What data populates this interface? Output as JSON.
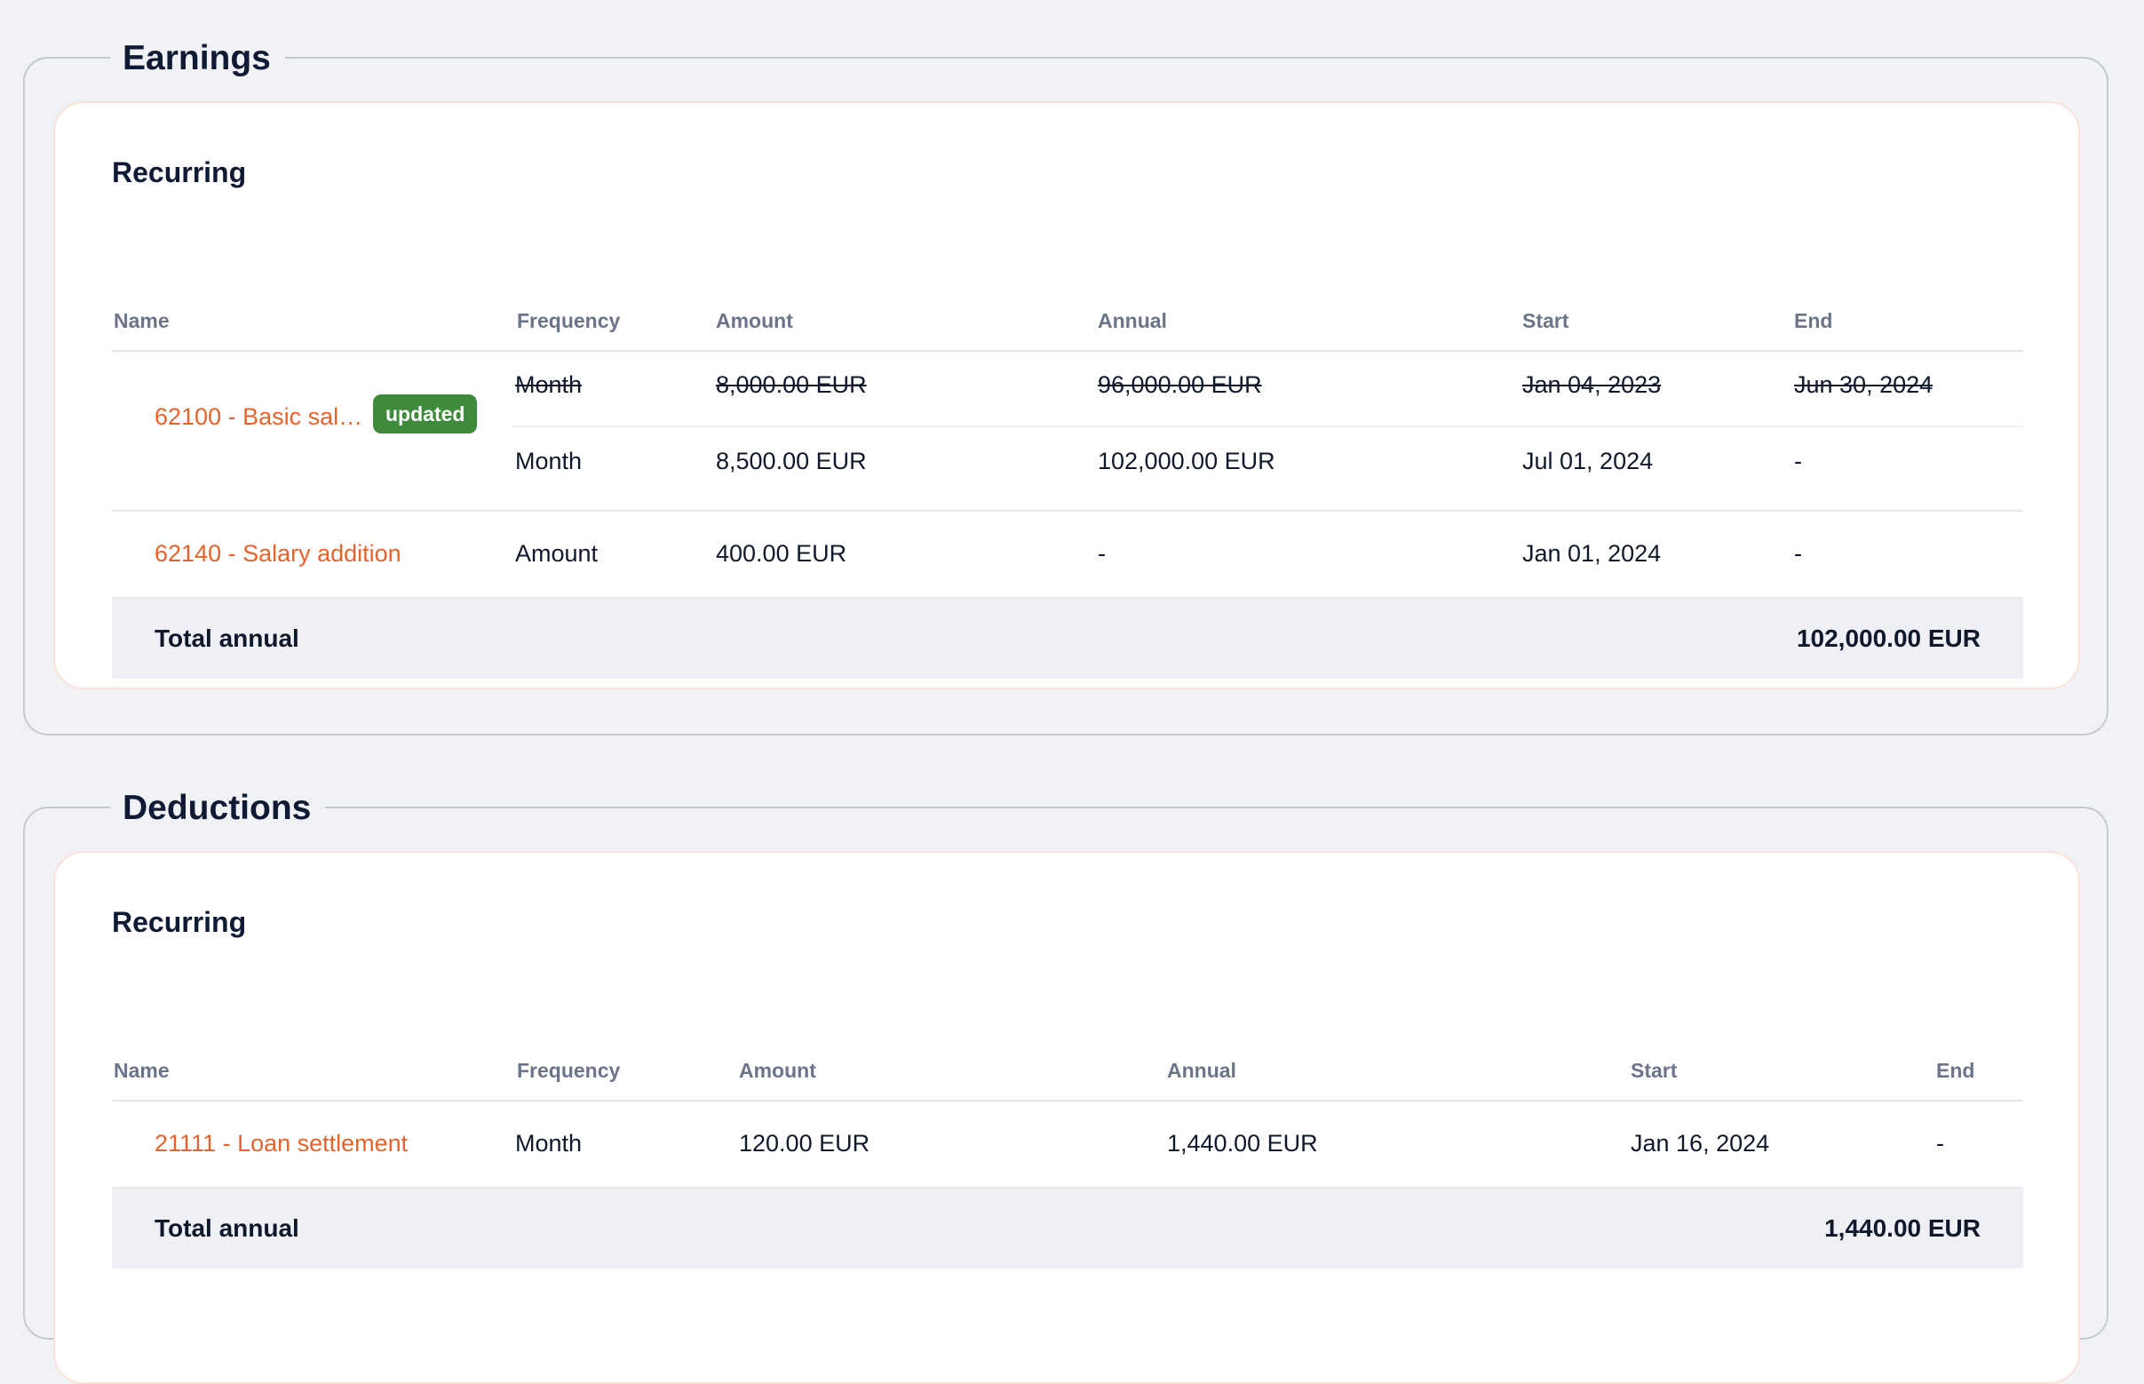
{
  "earnings": {
    "legend": "Earnings",
    "section_title": "Recurring",
    "columns": [
      "Name",
      "Frequency",
      "Amount",
      "Annual",
      "Start",
      "End"
    ],
    "rows": [
      {
        "name": "62100 - Basic sal…",
        "badge": "updated",
        "old": {
          "frequency": "Month",
          "amount": "8,000.00 EUR",
          "annual": "96,000.00 EUR",
          "start": "Jan 04, 2023",
          "end": "Jun 30, 2024"
        },
        "current": {
          "frequency": "Month",
          "amount": "8,500.00 EUR",
          "annual": "102,000.00 EUR",
          "start": "Jul 01, 2024",
          "end": "-"
        }
      },
      {
        "name": "62140 - Salary addition",
        "frequency": "Amount",
        "amount": "400.00 EUR",
        "annual": "-",
        "start": "Jan 01, 2024",
        "end": "-"
      }
    ],
    "total_label": "Total annual",
    "total_value": "102,000.00 EUR"
  },
  "deductions": {
    "legend": "Deductions",
    "section_title": "Recurring",
    "columns": [
      "Name",
      "Frequency",
      "Amount",
      "Annual",
      "Start",
      "End"
    ],
    "rows": [
      {
        "name": "21111 - Loan settlement",
        "frequency": "Month",
        "amount": "120.00 EUR",
        "annual": "1,440.00 EUR",
        "start": "Jan 16, 2024",
        "end": "-"
      }
    ],
    "total_label": "Total annual",
    "total_value": "1,440.00 EUR"
  },
  "colors": {
    "link": "#e8632b",
    "badge": "#3f8a3c",
    "background": "#f1f2f6"
  }
}
